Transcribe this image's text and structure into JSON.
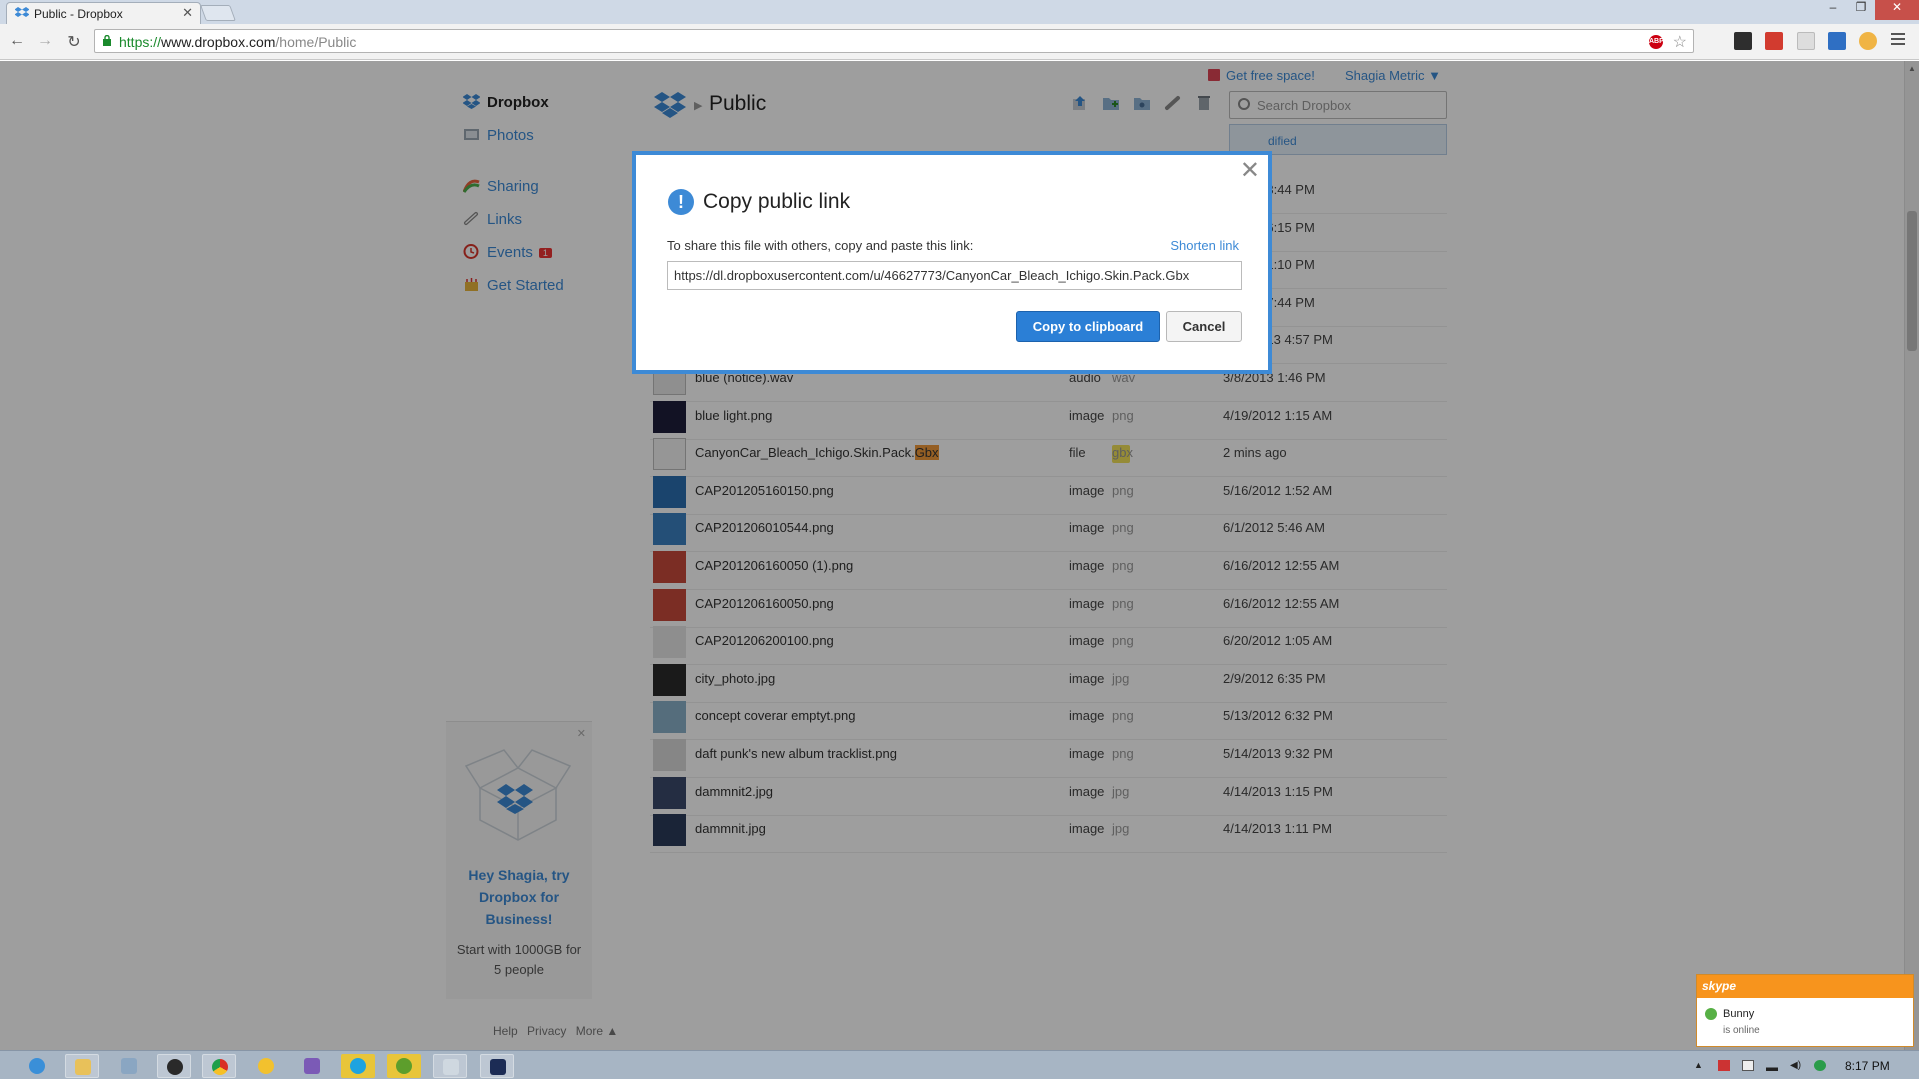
{
  "browser": {
    "tab_title": "Public - Dropbox",
    "url_scheme": "https://",
    "url_host": "www.dropbox.com",
    "url_path": "/home/Public",
    "window_controls": [
      "–",
      "❐",
      "✕"
    ]
  },
  "header": {
    "get_free_space": "Get free space!",
    "account_name": "Shagia Metric ▼"
  },
  "sidebar": {
    "items": [
      {
        "label": "Dropbox",
        "icon": "dropbox-icon"
      },
      {
        "label": "Photos",
        "icon": "photos-icon"
      },
      {
        "label": "Sharing",
        "icon": "sharing-icon"
      },
      {
        "label": "Links",
        "icon": "links-icon"
      },
      {
        "label": "Events",
        "icon": "events-icon",
        "badge": "1"
      },
      {
        "label": "Get Started",
        "icon": "get-started-icon"
      }
    ],
    "promo_title": "Hey Shagia, try Dropbox for Business!",
    "promo_sub": "Start with 1000GB for 5 people",
    "footer_help": "Help",
    "footer_privacy": "Privacy",
    "footer_more": "More ▲"
  },
  "main": {
    "breadcrumb_folder": "Public",
    "search_placeholder": "Search Dropbox",
    "modified_header": "dified",
    "files": [
      {
        "name": "",
        "kind": "",
        "ext": "",
        "modified": "7/2012 3:44 PM"
      },
      {
        "name": "",
        "kind": "",
        "ext": "",
        "modified": "5/2012 6:15 PM"
      },
      {
        "name": "",
        "kind": "",
        "ext": "",
        "modified": "2/2013 1:10 PM"
      },
      {
        "name": "",
        "kind": "",
        "ext": "",
        "modified": "0/2013 7:44 PM"
      },
      {
        "name": "black and white.png",
        "kind": "image",
        "ext": "png",
        "modified": "5/16/2013 4:57 PM"
      },
      {
        "name": "blue (notice).wav",
        "kind": "audio",
        "ext": "wav",
        "modified": "3/8/2013 1:46 PM"
      },
      {
        "name": "blue light.png",
        "kind": "image",
        "ext": "png",
        "modified": "4/19/2012 1:15 AM"
      },
      {
        "name": "CanyonCar_Bleach_Ichigo.Skin.Pack.",
        "name_highlight": "Gbx",
        "kind": "file",
        "ext": "gbx",
        "modified": "2 mins ago"
      },
      {
        "name": "CAP201205160150.png",
        "kind": "image",
        "ext": "png",
        "modified": "5/16/2012 1:52 AM"
      },
      {
        "name": "CAP201206010544.png",
        "kind": "image",
        "ext": "png",
        "modified": "6/1/2012 5:46 AM"
      },
      {
        "name": "CAP201206160050 (1).png",
        "kind": "image",
        "ext": "png",
        "modified": "6/16/2012 12:55 AM"
      },
      {
        "name": "CAP201206160050.png",
        "kind": "image",
        "ext": "png",
        "modified": "6/16/2012 12:55 AM"
      },
      {
        "name": "CAP201206200100.png",
        "kind": "image",
        "ext": "png",
        "modified": "6/20/2012 1:05 AM"
      },
      {
        "name": "city_photo.jpg",
        "kind": "image",
        "ext": "jpg",
        "modified": "2/9/2012 6:35 PM"
      },
      {
        "name": "concept coverar emptyt.png",
        "kind": "image",
        "ext": "png",
        "modified": "5/13/2012 6:32 PM"
      },
      {
        "name": "daft punk's new album tracklist.png",
        "kind": "image",
        "ext": "png",
        "modified": "5/14/2013 9:32 PM"
      },
      {
        "name": "dammnit2.jpg",
        "kind": "image",
        "ext": "jpg",
        "modified": "4/14/2013 1:15 PM"
      },
      {
        "name": "dammnit.jpg",
        "kind": "image",
        "ext": "jpg",
        "modified": "4/14/2013 1:11 PM"
      }
    ]
  },
  "dialog": {
    "title": "Copy public link",
    "instruction": "To share this file with others, copy and paste this link:",
    "shorten_link": "Shorten link",
    "link_value": "https://dl.dropboxusercontent.com/u/46627773/CanyonCar_Bleach_Ichigo.Skin.Pack.Gbx",
    "copy_button": "Copy to clipboard",
    "cancel_button": "Cancel",
    "close_symbol": "✕"
  },
  "skype_toast": {
    "logo": "skype",
    "contact": "Bunny",
    "status": "is online"
  },
  "taskbar": {
    "clock": "8:17 PM"
  },
  "colors": {
    "accent": "#3d8ad6",
    "primary_button": "#2b7fd6",
    "skype_orange": "#f7941d"
  }
}
